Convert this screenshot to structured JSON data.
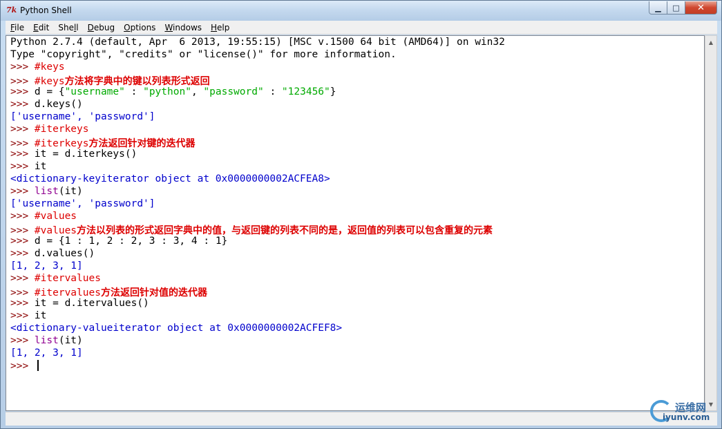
{
  "window": {
    "title": "Python Shell",
    "title_icon": "7k",
    "controls": {
      "minimize": "▁",
      "maximize": "□",
      "close": "✕"
    }
  },
  "menu": [
    {
      "underline": "F",
      "rest": "ile"
    },
    {
      "underline": "E",
      "rest": "dit"
    },
    {
      "underline": "",
      "rest": "She",
      "underline2": "l",
      "rest2": "l"
    },
    {
      "underline": "D",
      "rest": "ebug"
    },
    {
      "underline": "O",
      "rest": "ptions"
    },
    {
      "underline": "W",
      "rest": "indows"
    },
    {
      "underline": "H",
      "rest": "elp"
    }
  ],
  "shell": {
    "banner1": "Python 2.7.4 (default, Apr  6 2013, 19:55:15) [MSC v.1500 64 bit (AMD64)] on win32",
    "banner2": "Type \"copyright\", \"credits\" or \"license()\" for more information.",
    "prompt": ">>> ",
    "c1": "#keys",
    "c2_code": "#keys",
    "c2_cjk": "方法将字典中的键以列表形式返回",
    "l3_a": "d = {",
    "l3_s1": "\"username\"",
    "l3_b": " : ",
    "l3_s2": "\"python\"",
    "l3_c": ", ",
    "l3_s3": "\"password\"",
    "l3_d": " : ",
    "l3_s4": "\"123456\"",
    "l3_e": "}",
    "l4": "d.keys()",
    "o1": "['username', 'password']",
    "c3": "#iterkeys",
    "c4_code": "#iterkeys",
    "c4_cjk": "方法返回针对键的迭代器",
    "l5": "it = d.iterkeys()",
    "l6": "it",
    "o2": "<dictionary-keyiterator object at 0x0000000002ACFEA8>",
    "l7_fn": "list",
    "l7_rest": "(it)",
    "o3": "['username', 'password']",
    "c5": "#values",
    "c6_code": "#values",
    "c6_cjk": "方法以列表的形式返回字典中的值，与返回键的列表不同的是，返回值的列表可以包含重复的元素",
    "l8": "d = {1 : 1, 2 : 2, 3 : 3, 4 : 1}",
    "l9": "d.values()",
    "o4": "[1, 2, 3, 1]",
    "c7": "#itervalues",
    "c8_code": "#itervalues",
    "c8_cjk": "方法返回针对值的迭代器",
    "l10": "it = d.itervalues()",
    "l11": "it",
    "o5": "<dictionary-valueiterator object at 0x0000000002ACFEF8>",
    "l12_fn": "list",
    "l12_rest": "(it)",
    "o6": "[1, 2, 3, 1]"
  },
  "watermark": {
    "top": "运维网",
    "bottom": "iyunv.com"
  },
  "colors": {
    "prompt": "#8b0000",
    "comment": "#dd0000",
    "builtin": "#900090",
    "string": "#00aa00",
    "stdout": "#0000cc"
  }
}
